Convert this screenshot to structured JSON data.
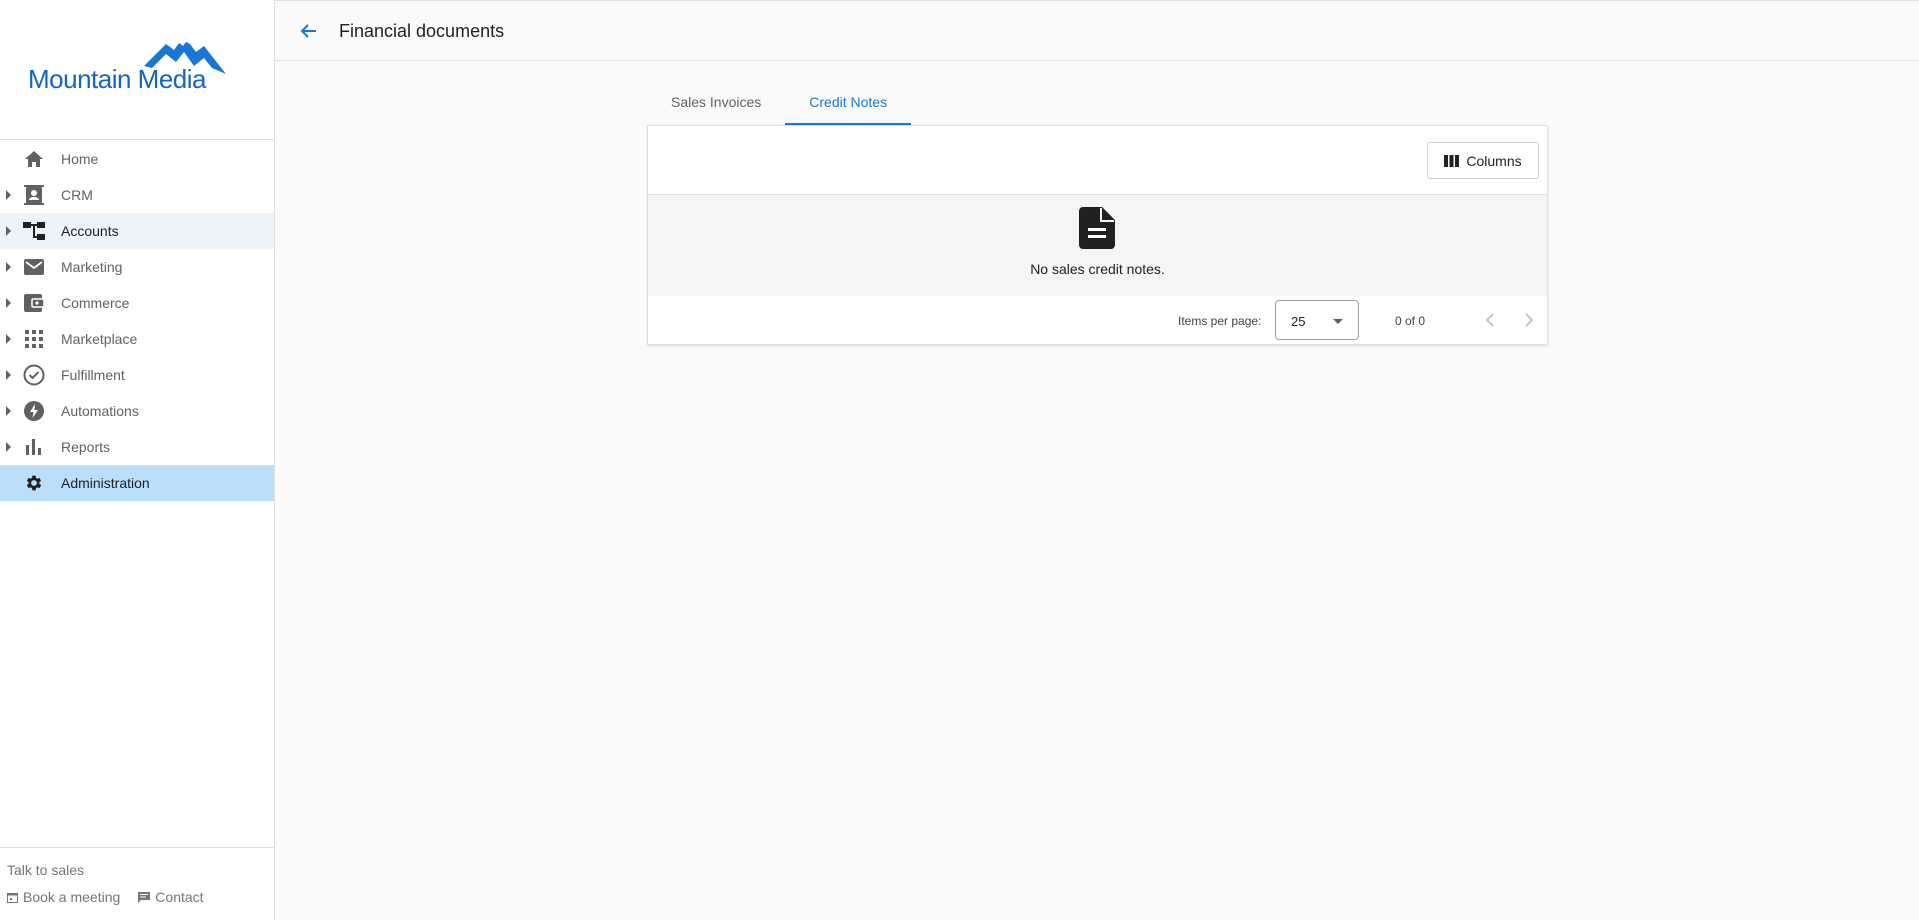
{
  "brand": {
    "name": "Mountain Media",
    "color": "#1976d2"
  },
  "sidebar": {
    "items": [
      {
        "label": "Home",
        "icon": "home-icon",
        "expandable": false
      },
      {
        "label": "CRM",
        "icon": "contact-card-icon",
        "expandable": true
      },
      {
        "label": "Accounts",
        "icon": "account-tree-icon",
        "expandable": true
      },
      {
        "label": "Marketing",
        "icon": "mail-icon",
        "expandable": true
      },
      {
        "label": "Commerce",
        "icon": "wallet-icon",
        "expandable": true
      },
      {
        "label": "Marketplace",
        "icon": "apps-grid-icon",
        "expandable": true
      },
      {
        "label": "Fulfillment",
        "icon": "check-circle-icon",
        "expandable": true
      },
      {
        "label": "Automations",
        "icon": "bolt-icon",
        "expandable": true
      },
      {
        "label": "Reports",
        "icon": "bar-chart-icon",
        "expandable": true
      },
      {
        "label": "Administration",
        "icon": "gear-icon",
        "expandable": false,
        "active": true
      }
    ],
    "footer": {
      "talk_label": "Talk to sales",
      "book_label": "Book a meeting",
      "contact_label": "Contact"
    }
  },
  "header": {
    "title": "Financial documents"
  },
  "tabs": [
    {
      "label": "Sales Invoices",
      "active": false
    },
    {
      "label": "Credit Notes",
      "active": true
    }
  ],
  "table": {
    "columns_button": "Columns",
    "empty_message": "No sales credit notes.",
    "paginator": {
      "items_per_page_label": "Items per page:",
      "items_per_page": "25",
      "range_label": "0 of 0"
    }
  }
}
